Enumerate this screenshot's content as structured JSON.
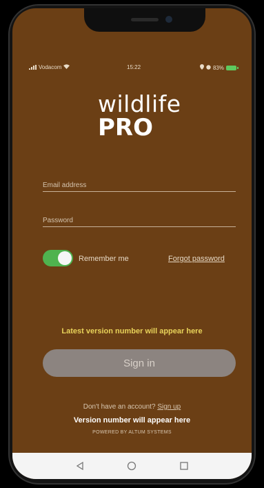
{
  "status": {
    "carrier": "Vodacom",
    "time": "15:22",
    "battery": "83%"
  },
  "logo": {
    "line1": "wildlife",
    "line2": "PRO"
  },
  "form": {
    "email_placeholder": "Email address",
    "password_placeholder": "Password",
    "remember_label": "Remember me",
    "remember_on": true,
    "forgot_label": "Forgot password",
    "latest_version": "Latest version number will appear here",
    "signin_label": "Sign in"
  },
  "footer": {
    "no_account": "Don't have an account?",
    "signup_label": "Sign up",
    "version": "Version number will appear here",
    "powered": "POWERED BY ALTUM SYSTEMS"
  },
  "colors": {
    "background": "#6b3f15",
    "toggle_on": "#4fb34f",
    "latest_text": "#e8d35a"
  }
}
